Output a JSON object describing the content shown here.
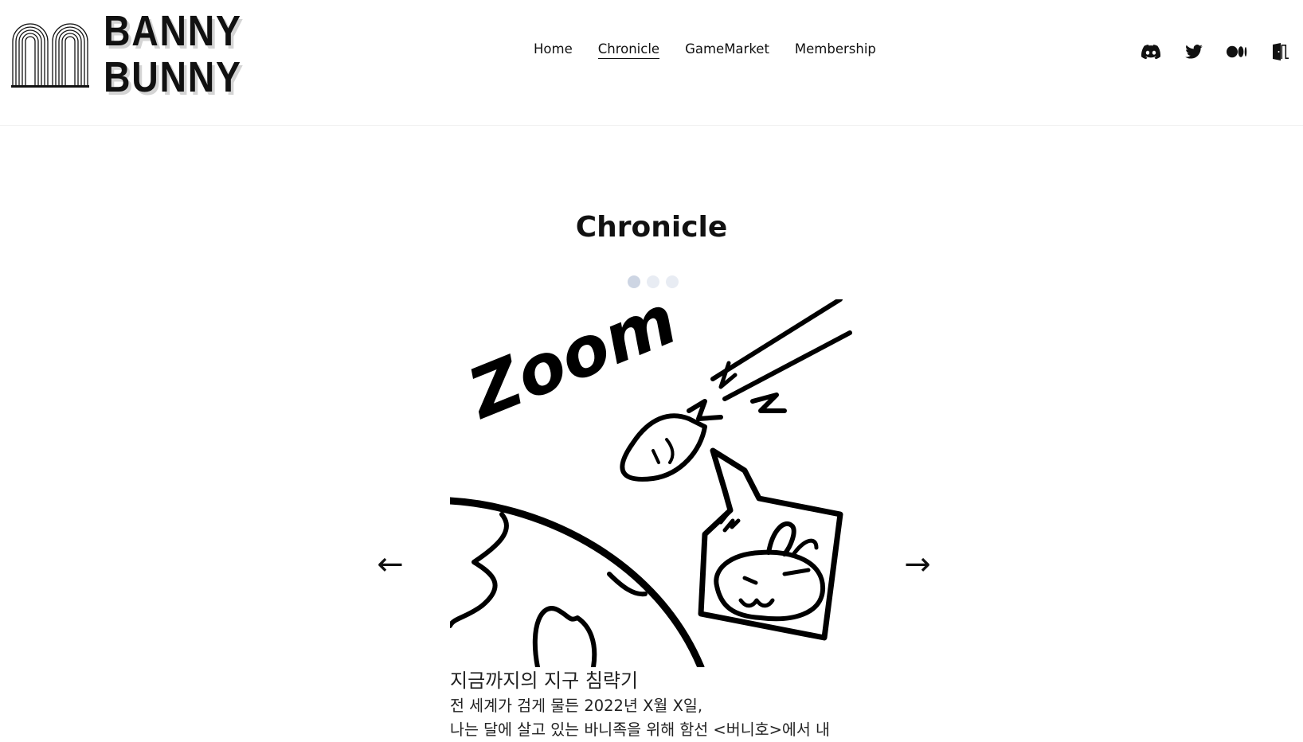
{
  "brand": {
    "line1": "BANNY",
    "line2": "BUNNY"
  },
  "nav": {
    "items": [
      {
        "label": "Home"
      },
      {
        "label": "Chronicle"
      },
      {
        "label": "GameMarket"
      },
      {
        "label": "Membership"
      }
    ],
    "active_index": 1
  },
  "socials": [
    {
      "icon": "discord-icon"
    },
    {
      "icon": "twitter-icon"
    },
    {
      "icon": "medium-icon"
    },
    {
      "icon": "door-exit-icon"
    }
  ],
  "page": {
    "title": "Chronicle"
  },
  "carousel": {
    "dot_count": 3,
    "active_dot": 0,
    "prev_label": "←",
    "next_label": "→",
    "image_text": "Zoom",
    "slide": {
      "title": "지금까지의 지구 침략기",
      "lines": [
        "전 세계가 검게 물든 2022년 X월 X일,",
        "나는 달에 살고 있는 바니족을 위해 함선 <버니호>에서 내"
      ]
    }
  },
  "colors": {
    "dot_active": "#cdd5e3",
    "dot_inactive": "#e8ecf3",
    "text": "#111111"
  }
}
